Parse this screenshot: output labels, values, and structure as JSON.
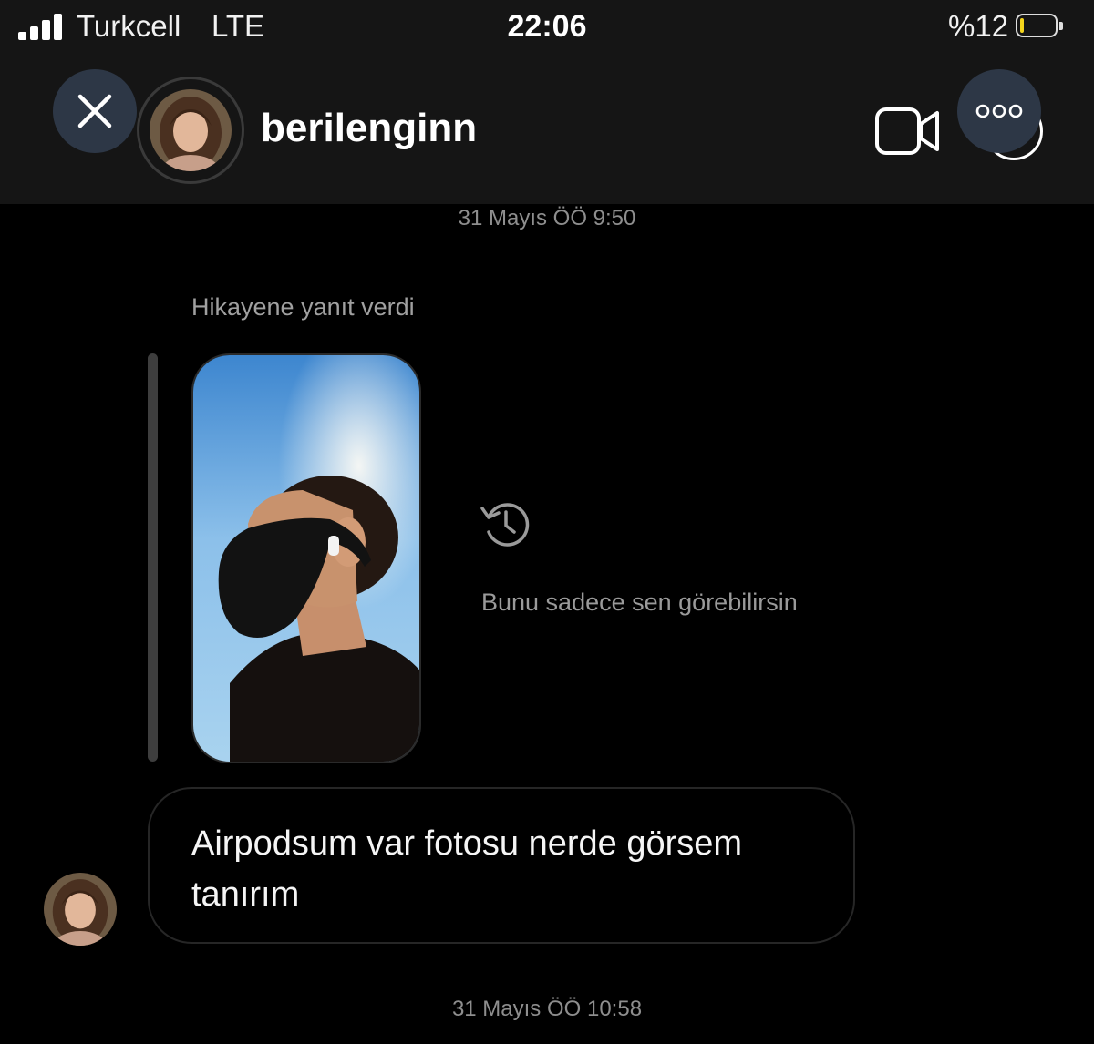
{
  "status_bar": {
    "carrier": "Turkcell",
    "network": "LTE",
    "time": "22:06",
    "battery_text": "%12",
    "battery_level": 0.12,
    "battery_color": "#f4d51c",
    "signal_icon": "signal-bars-icon"
  },
  "header": {
    "username": "berilenginn",
    "close_icon": "close-icon",
    "video_icon": "video-camera-icon",
    "info_icon": "info-icon",
    "more_icon": "more-dots-icon"
  },
  "chat": {
    "timestamp_1": "31 Mayıs ÖÖ 9:50",
    "story_reply_label": "Hikayene yanıt verdi",
    "expired_icon": "history-clock-icon",
    "expired_text": "Bunu sadece sen görebilirsin",
    "message_text": "Airpodsum var fotosu nerde görsem tanırım",
    "timestamp_2": "31 Mayıs ÖÖ 10:58"
  },
  "colors": {
    "header_bg": "#151515",
    "overlay_button_bg": "#2d3746",
    "background": "#000000"
  }
}
